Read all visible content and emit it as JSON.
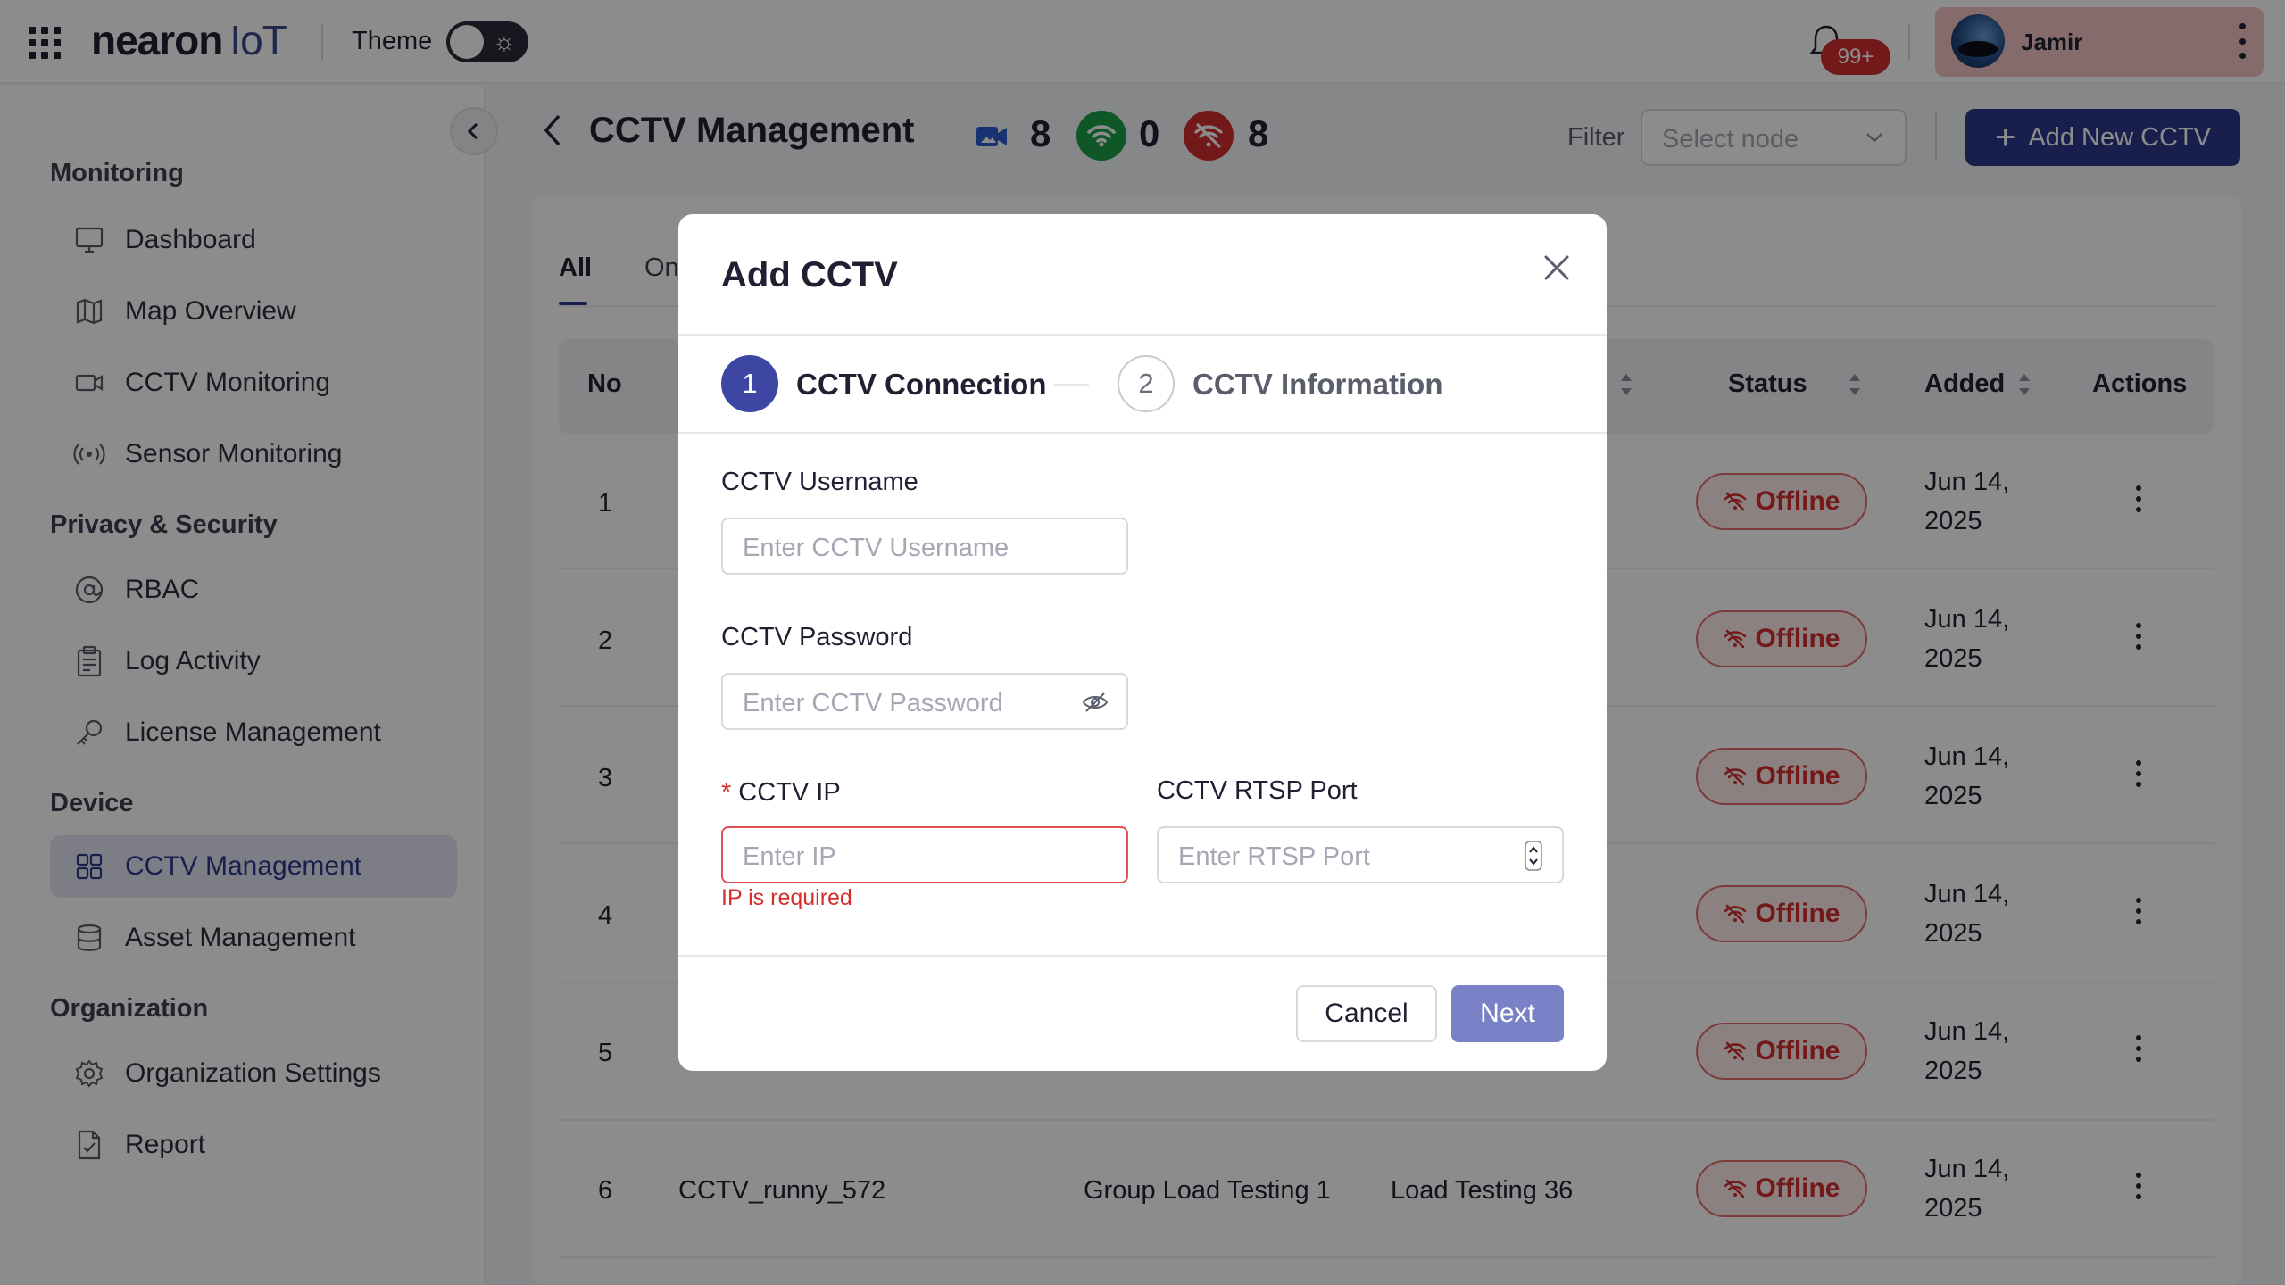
{
  "app": {
    "logo_main": "nearon",
    "logo_suffix": "IoT",
    "theme_label": "Theme",
    "notification_count": "99+",
    "user_name": "Jamir"
  },
  "sidebar": {
    "sections": [
      {
        "title": "Monitoring",
        "items": [
          {
            "label": "Dashboard",
            "icon": "monitor-icon"
          },
          {
            "label": "Map Overview",
            "icon": "map-icon"
          },
          {
            "label": "CCTV Monitoring",
            "icon": "video-camera-icon"
          },
          {
            "label": "Sensor Monitoring",
            "icon": "sensor-broadcast-icon"
          }
        ]
      },
      {
        "title": "Privacy & Security",
        "items": [
          {
            "label": "RBAC",
            "icon": "at-sign-icon"
          },
          {
            "label": "Log Activity",
            "icon": "clipboard-icon"
          },
          {
            "label": "License Management",
            "icon": "key-icon"
          }
        ]
      },
      {
        "title": "Device",
        "items": [
          {
            "label": "CCTV Management",
            "icon": "grid-squares-icon",
            "active": true
          },
          {
            "label": "Asset Management",
            "icon": "database-icon"
          }
        ]
      },
      {
        "title": "Organization",
        "items": [
          {
            "label": "Organization Settings",
            "icon": "gear-icon"
          },
          {
            "label": "Report",
            "icon": "document-check-icon"
          }
        ]
      }
    ]
  },
  "header": {
    "title": "CCTV Management",
    "total_cameras": "8",
    "online_count": "0",
    "offline_count": "8",
    "filter_label": "Filter",
    "filter_placeholder": "Select node",
    "add_button": "Add New CCTV"
  },
  "tabs": [
    {
      "label": "All",
      "active": true
    },
    {
      "label": "On"
    }
  ],
  "table": {
    "columns": [
      "No",
      "Status",
      "Added",
      "Actions"
    ],
    "rows": [
      {
        "no": "1",
        "name": "",
        "group": "",
        "node": "",
        "status": "Offline",
        "added_line1": "Jun 14,",
        "added_line2": "2025"
      },
      {
        "no": "2",
        "name": "",
        "group": "",
        "node": "",
        "status": "Offline",
        "added_line1": "Jun 14,",
        "added_line2": "2025"
      },
      {
        "no": "3",
        "name": "",
        "group": "",
        "node": "",
        "status": "Offline",
        "added_line1": "Jun 14,",
        "added_line2": "2025"
      },
      {
        "no": "4",
        "name": "",
        "group": "",
        "node": "",
        "status": "Offline",
        "added_line1": "Jun 14,",
        "added_line2": "2025"
      },
      {
        "no": "5",
        "name": "",
        "group": "",
        "node": "",
        "status": "Offline",
        "added_line1": "Jun 14,",
        "added_line2": "2025"
      },
      {
        "no": "6",
        "name": "CCTV_runny_572",
        "group": "Group Load Testing 1",
        "node": "Load Testing 36",
        "status": "Offline",
        "added_line1": "Jun 14,",
        "added_line2": "2025"
      }
    ]
  },
  "modal": {
    "title": "Add CCTV",
    "steps": [
      {
        "number": "1",
        "label": "CCTV Connection",
        "active": true
      },
      {
        "number": "2",
        "label": "CCTV Information",
        "active": false
      }
    ],
    "fields": {
      "username": {
        "label": "CCTV Username",
        "placeholder": "Enter CCTV Username",
        "value": ""
      },
      "password": {
        "label": "CCTV Password",
        "placeholder": "Enter CCTV Password",
        "value": ""
      },
      "ip": {
        "label": "CCTV IP",
        "placeholder": "Enter IP",
        "value": "",
        "required": true,
        "error": "IP is required"
      },
      "rtsp_port": {
        "label": "CCTV RTSP Port",
        "placeholder": "Enter RTSP Port",
        "value": ""
      }
    },
    "cancel_label": "Cancel",
    "next_label": "Next"
  },
  "colors": {
    "brand": "#2e3a8c",
    "step_active": "#3d46a3",
    "offline": "#d12e2e",
    "online": "#1e9e4a",
    "camera": "#2f5bd0",
    "next_button": "#7a82c7"
  }
}
